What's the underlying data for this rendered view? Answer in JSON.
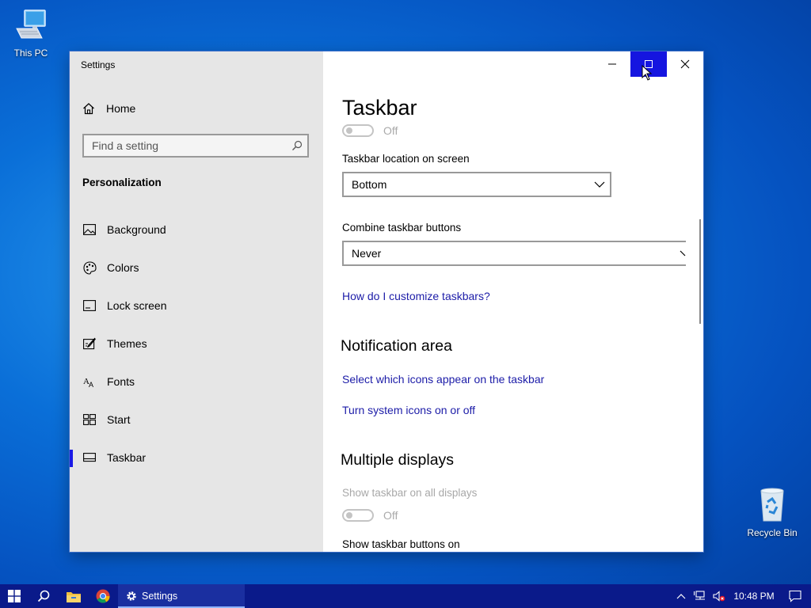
{
  "desktop": {
    "icons": [
      {
        "label": "This PC"
      },
      {
        "label": "Recycle Bin"
      }
    ]
  },
  "window": {
    "title": "Settings",
    "sidebar": {
      "home_label": "Home",
      "search_placeholder": "Find a setting",
      "section_title": "Personalization",
      "items": [
        {
          "label": "Background",
          "icon": "image-icon"
        },
        {
          "label": "Colors",
          "icon": "palette-icon"
        },
        {
          "label": "Lock screen",
          "icon": "lock-screen-icon"
        },
        {
          "label": "Themes",
          "icon": "themes-brush-icon"
        },
        {
          "label": "Fonts",
          "icon": "fonts-icon"
        },
        {
          "label": "Start",
          "icon": "start-tiles-icon"
        },
        {
          "label": "Taskbar",
          "icon": "taskbar-icon",
          "active": true
        }
      ]
    },
    "content": {
      "title": "Taskbar",
      "top_toggle_state": "Off",
      "location_label": "Taskbar location on screen",
      "location_value": "Bottom",
      "combine_label": "Combine taskbar buttons",
      "combine_value": "Never",
      "customize_link": "How do I customize taskbars?",
      "notification_heading": "Notification area",
      "notif_link_icons": "Select which icons appear on the taskbar",
      "notif_link_system": "Turn system icons on or off",
      "multiple_heading": "Multiple displays",
      "show_all_label": "Show taskbar on all displays",
      "show_all_state": "Off",
      "show_buttons_label": "Show taskbar buttons on"
    }
  },
  "taskbar": {
    "active_app": "Settings",
    "time": "10:48 PM"
  },
  "colors": {
    "accent": "#1515e0",
    "link": "#1c1ca8",
    "taskbar": "#0a1a8a"
  }
}
